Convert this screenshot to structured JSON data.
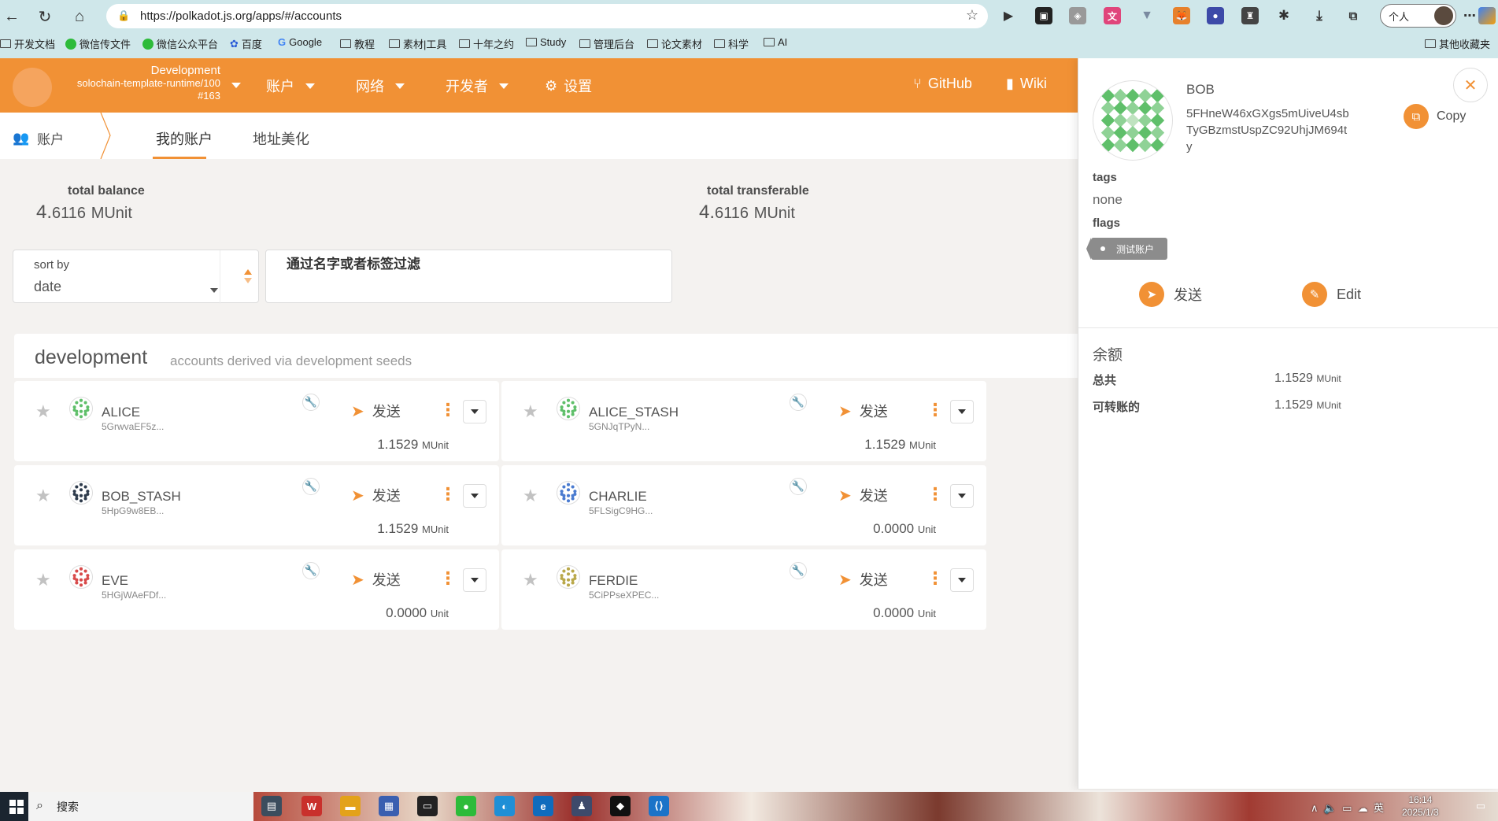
{
  "browser": {
    "url": "https://polkadot.js.org/apps/#/accounts",
    "profile_label": "个人",
    "bookmarks": [
      "开发文档",
      "微信传文件",
      "微信公众平台",
      "百度",
      "Google",
      "教程",
      "素材|工具",
      "十年之约",
      "Study",
      "管理后台",
      "论文素材",
      "科学",
      "AI"
    ],
    "other_bookmarks": "其他收藏夹"
  },
  "chain": {
    "network": "Development",
    "runtime": "solochain-template-runtime/100",
    "block": "#163"
  },
  "topnav": {
    "accounts": "账户",
    "network": "网络",
    "developer": "开发者",
    "settings": "设置",
    "github": "GitHub",
    "wiki": "Wiki"
  },
  "tabs": {
    "section": "账户",
    "my_accounts": "我的账户",
    "address_book": "地址美化"
  },
  "summary": {
    "total_balance_label": "total balance",
    "total_balance_int": "4.",
    "total_balance_dec": "6116",
    "total_balance_unit": "MUnit",
    "transferable_label": "total transferable",
    "transferable_int": "4.",
    "transferable_dec": "6116",
    "transferable_unit": "MUnit"
  },
  "filters": {
    "sort_label": "sort by",
    "sort_value": "date",
    "filter_placeholder": "通过名字或者标签过滤"
  },
  "group": {
    "title": "development",
    "subtitle": "accounts derived via development seeds"
  },
  "send_label": "发送",
  "accounts": [
    {
      "name": "ALICE",
      "addr": "5GrwvaEF5z...",
      "bal_int": "1.",
      "bal_dec": "1529",
      "unit": "MUnit"
    },
    {
      "name": "ALICE_STASH",
      "addr": "5GNJqTPyN...",
      "bal_int": "1.",
      "bal_dec": "1529",
      "unit": "MUnit"
    },
    {
      "name": "BOB_STASH",
      "addr": "5HpG9w8EB...",
      "bal_int": "1.",
      "bal_dec": "1529",
      "unit": "MUnit"
    },
    {
      "name": "CHARLIE",
      "addr": "5FLSigC9HG...",
      "bal_int": "0.",
      "bal_dec": "0000",
      "unit": "Unit"
    },
    {
      "name": "EVE",
      "addr": "5HGjWAeFDf...",
      "bal_int": "0.",
      "bal_dec": "0000",
      "unit": "Unit"
    },
    {
      "name": "FERDIE",
      "addr": "5CiPPseXPEC...",
      "bal_int": "0.",
      "bal_dec": "0000",
      "unit": "Unit"
    }
  ],
  "sidebar": {
    "name": "BOB",
    "address": "5FHneW46xGXgs5mUiveU4sbTyGBzmstUspZC92UhjJM694ty",
    "copy": "Copy",
    "tags_label": "tags",
    "tags_value": "none",
    "flags_label": "flags",
    "flag": "测试账户",
    "send": "发送",
    "edit": "Edit",
    "balance_title": "余额",
    "total_label": "总共",
    "total_int": "1.",
    "total_dec": "1529",
    "total_unit": "MUnit",
    "transferable_label": "可转账的",
    "transferable_int": "1.",
    "transferable_dec": "1529",
    "transferable_unit": "MUnit"
  },
  "taskbar": {
    "search": "搜索",
    "ime": "英",
    "time": "16:14",
    "date": "2025/1/3"
  }
}
